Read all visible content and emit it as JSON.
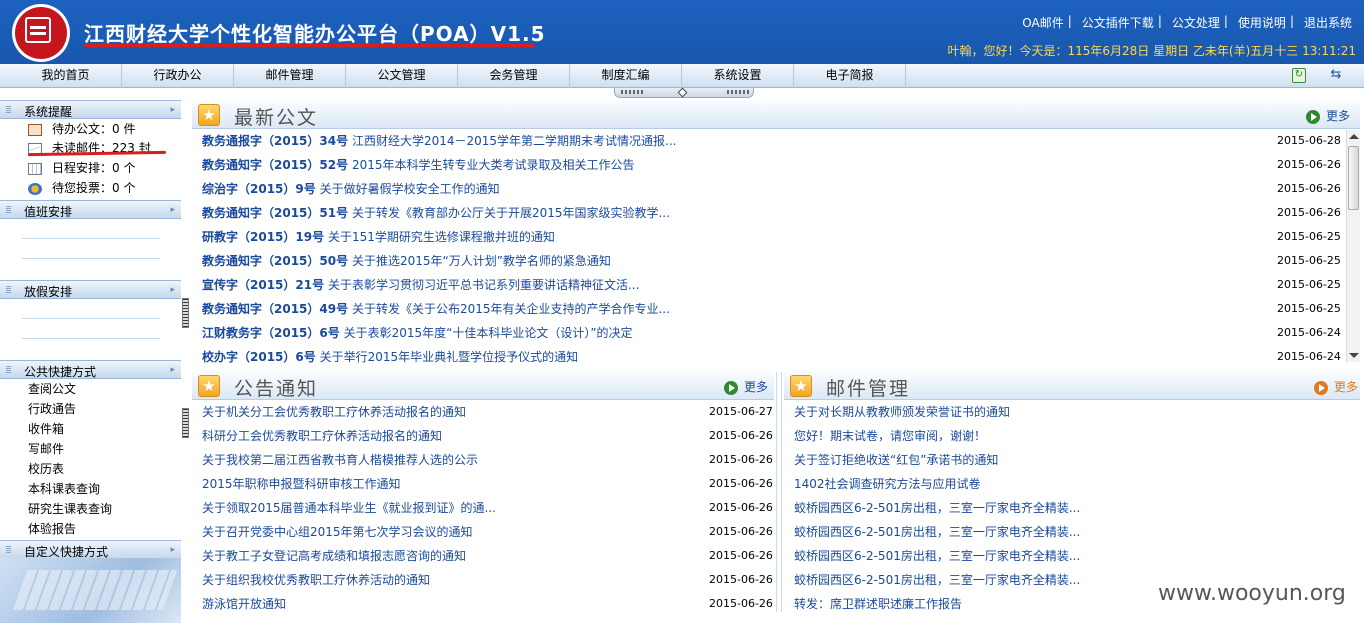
{
  "header": {
    "title": "江西财经大学个性化智能办公平台（POA）V1.5",
    "top_links": [
      "OA邮件",
      "公文插件下载",
      "公文处理",
      "使用说明",
      "退出系统"
    ],
    "greeting": "叶翰，您好！今天是：115年6月28日 星期日 乙未年(羊)五月十三 13:11:21"
  },
  "nav": {
    "items": [
      "我的首页",
      "行政办公",
      "邮件管理",
      "公文管理",
      "会务管理",
      "制度汇编",
      "系统设置",
      "电子简报"
    ]
  },
  "sidebar": {
    "sections": {
      "alerts": "系统提醒",
      "duty": "值班安排",
      "holiday": "放假安排",
      "shortcuts": "公共快捷方式",
      "custom": "自定义快捷方式"
    },
    "alerts": [
      {
        "label": "待办公文：0 件",
        "icon": "document-edit-icon"
      },
      {
        "label": "未读邮件：223 封",
        "icon": "mail-icon"
      },
      {
        "label": "日程安排：0 个",
        "icon": "calendar-icon"
      },
      {
        "label": "待您投票：0 个",
        "icon": "vote-icon"
      }
    ],
    "shortcuts": [
      "查阅公文",
      "行政通告",
      "收件箱",
      "写邮件",
      "校历表",
      "本科课表查询",
      "研究生课表查询",
      "体验报告"
    ]
  },
  "latest_docs": {
    "title": "最新公文",
    "more": "更多",
    "items": [
      {
        "code": "教务通报字（2015）34号",
        "title": "江西财经大学2014－2015学年第二学期期末考试情况通报...",
        "date": "2015-06-28"
      },
      {
        "code": "教务通知字（2015）52号",
        "title": "2015年本科学生转专业大类考试录取及相关工作公告",
        "date": "2015-06-26"
      },
      {
        "code": "综治字（2015）9号",
        "title": "关于做好暑假学校安全工作的通知",
        "date": "2015-06-26"
      },
      {
        "code": "教务通知字（2015）51号",
        "title": "关于转发《教育部办公厅关于开展2015年国家级实验教学...",
        "date": "2015-06-26"
      },
      {
        "code": "研教字（2015）19号",
        "title": "关于151学期研究生选修课程撤并班的通知",
        "date": "2015-06-25"
      },
      {
        "code": "教务通知字（2015）50号",
        "title": "关于推选2015年“万人计划”教学名师的紧急通知",
        "date": "2015-06-25"
      },
      {
        "code": "宣传字（2015）21号",
        "title": "关于表彰学习贯彻习近平总书记系列重要讲话精神征文活...",
        "date": "2015-06-25"
      },
      {
        "code": "教务通知字（2015）49号",
        "title": "关于转发《关于公布2015年有关企业支持的产学合作专业...",
        "date": "2015-06-25"
      },
      {
        "code": "江财教务字（2015）6号",
        "title": "关于表彰2015年度“十佳本科毕业论文（设计）”的决定",
        "date": "2015-06-24"
      },
      {
        "code": "校办字（2015）6号",
        "title": "关于举行2015年毕业典礼暨学位授予仪式的通知",
        "date": "2015-06-24"
      }
    ]
  },
  "notices": {
    "title": "公告通知",
    "more": "更多",
    "items": [
      {
        "title": "关于机关分工会优秀教职工疗休养活动报名的通知",
        "date": "2015-06-27"
      },
      {
        "title": "科研分工会优秀教职工疗休养活动报名的通知",
        "date": "2015-06-26"
      },
      {
        "title": "关于我校第二届江西省教书育人楷模推荐人选的公示",
        "date": "2015-06-26"
      },
      {
        "title": "2015年职称申报暨科研审核工作通知",
        "date": "2015-06-26"
      },
      {
        "title": "关于领取2015届普通本科毕业生《就业报到证》的通...",
        "date": "2015-06-26"
      },
      {
        "title": "关于召开党委中心组2015年第七次学习会议的通知",
        "date": "2015-06-26"
      },
      {
        "title": "关于教工子女登记高考成绩和填报志愿咨询的通知",
        "date": "2015-06-26"
      },
      {
        "title": "关于组织我校优秀教职工疗休养活动的通知",
        "date": "2015-06-26"
      },
      {
        "title": "游泳馆开放通知",
        "date": "2015-06-26"
      }
    ]
  },
  "mail": {
    "title": "邮件管理",
    "more": "更多",
    "items": [
      "关于对长期从教教师颁发荣誉证书的通知",
      "您好！期末试卷，请您审阅，谢谢！",
      "关于签订拒绝收送“红包”承诺书的通知",
      "1402社会调查研究方法与应用试卷",
      "蛟桥园西区6-2-501房出租，三室一厅家电齐全精装...",
      "蛟桥园西区6-2-501房出租，三室一厅家电齐全精装...",
      "蛟桥园西区6-2-501房出租，三室一厅家电齐全精装...",
      "蛟桥园西区6-2-501房出租，三室一厅家电齐全精装...",
      "转发：席卫群述职述廉工作报告"
    ]
  },
  "watermark": "www.wooyun.org",
  "colors": {
    "header_bg": "#1c62bf",
    "link": "#1b4a9b",
    "accent_red": "#d81e1e",
    "greeting": "#ffd84a"
  }
}
